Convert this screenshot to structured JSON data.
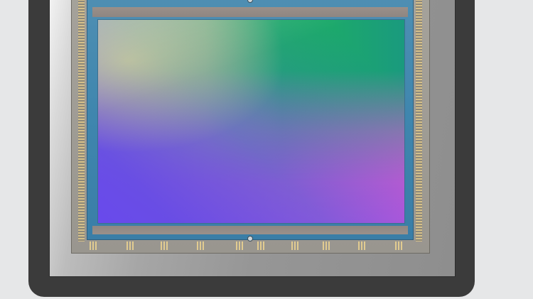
{
  "image": {
    "subject": "",
    "colors": {
      "background": "#e6e7e8",
      "package": "#3b3b3b",
      "die": "#3f86ae",
      "array_green": "#1eb35e",
      "array_yellow": "#d9df7a",
      "array_magenta": "#e252de",
      "array_violet": "#694aec",
      "pads_gold": "#d8c28a"
    }
  }
}
